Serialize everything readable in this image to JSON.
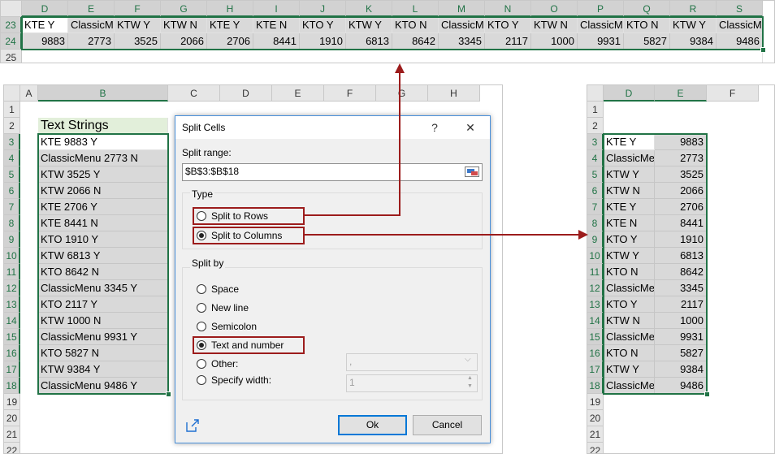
{
  "top_sheet": {
    "columns": [
      "D",
      "E",
      "F",
      "G",
      "H",
      "I",
      "J",
      "K",
      "L",
      "M",
      "N",
      "O",
      "P",
      "Q",
      "R",
      "S"
    ],
    "rows": [
      "23",
      "24",
      "25"
    ],
    "row23": [
      "KTE  Y",
      "ClassicM",
      "KTW  Y",
      "KTW  N",
      "KTE  Y",
      "KTE  N",
      "KTO  Y",
      "KTW  Y",
      "KTO  N",
      "ClassicM",
      "KTO  Y",
      "KTW  N",
      "ClassicM",
      "KTO  N",
      "KTW  Y",
      "ClassicM"
    ],
    "row24": [
      "9883",
      "2773",
      "3525",
      "2066",
      "2706",
      "8441",
      "1910",
      "6813",
      "8642",
      "3345",
      "2117",
      "1000",
      "9931",
      "5827",
      "9384",
      "9486"
    ]
  },
  "left_sheet": {
    "columns": [
      "A",
      "B",
      "C",
      "D",
      "E",
      "F",
      "G",
      "H"
    ],
    "rows": [
      "1",
      "2",
      "3",
      "4",
      "5",
      "6",
      "7",
      "8",
      "9",
      "10",
      "11",
      "12",
      "13",
      "14",
      "15",
      "16",
      "17",
      "18",
      "19",
      "20",
      "21",
      "22"
    ],
    "header": "Text Strings",
    "values": [
      "KTE 9883 Y",
      "ClassicMenu 2773 N",
      "KTW 3525 Y",
      "KTW 2066 N",
      "KTE 2706 Y",
      "KTE 8441 N",
      "KTO 1910 Y",
      "KTW 6813 Y",
      "KTO 8642 N",
      "ClassicMenu 3345 Y",
      "KTO 2117 Y",
      "KTW 1000 N",
      "ClassicMenu 9931 Y",
      "KTO 5827 N",
      "KTW 9384 Y",
      "ClassicMenu 9486 Y"
    ]
  },
  "right_sheet": {
    "columns": [
      "D",
      "E",
      "F"
    ],
    "rows": [
      "1",
      "2",
      "3",
      "4",
      "5",
      "6",
      "7",
      "8",
      "9",
      "10",
      "11",
      "12",
      "13",
      "14",
      "15",
      "16",
      "17",
      "18",
      "19",
      "20",
      "21",
      "22"
    ],
    "col_d": [
      "KTE  Y",
      "ClassicMe",
      "KTW  Y",
      "KTW  N",
      "KTE  Y",
      "KTE  N",
      "KTO  Y",
      "KTW  Y",
      "KTO  N",
      "ClassicMe",
      "KTO  Y",
      "KTW  N",
      "ClassicMe",
      "KTO  N",
      "KTW  Y",
      "ClassicMe"
    ],
    "col_e": [
      "9883",
      "2773",
      "3525",
      "2066",
      "2706",
      "8441",
      "1910",
      "6813",
      "8642",
      "3345",
      "2117",
      "1000",
      "9931",
      "5827",
      "9384",
      "9486"
    ]
  },
  "dialog": {
    "title": "Split Cells",
    "help": "?",
    "close": "✕",
    "split_range_label": "Split range:",
    "split_range_value": "$B$3:$B$18",
    "type_label": "Type",
    "type_options": [
      "Split to Rows",
      "Split to Columns"
    ],
    "split_by_label": "Split by",
    "split_by_options": [
      "Space",
      "New line",
      "Semicolon",
      "Text and number",
      "Other:",
      "Specify width:"
    ],
    "other_value": ",",
    "width_value": "1",
    "ok": "Ok",
    "cancel": "Cancel"
  },
  "colors": {
    "selection": "#217346",
    "highlight": "#9c1c1c",
    "dialog_border": "#4a90d9"
  }
}
